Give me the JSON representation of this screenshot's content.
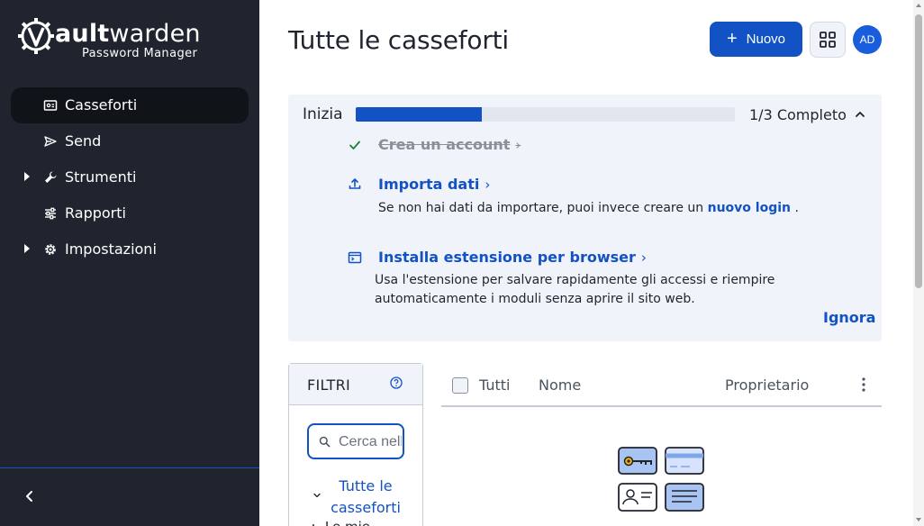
{
  "brand": {
    "word_light": "ault",
    "word_rest": "warden",
    "subtitle": "Password Manager",
    "logo_icon": "gear-v-logo"
  },
  "sidebar": {
    "items": [
      {
        "label": "Casseforti",
        "icon": "vault-icon",
        "active": true
      },
      {
        "label": "Send",
        "icon": "send-icon",
        "active": false
      },
      {
        "label": "Strumenti",
        "icon": "wrench-icon",
        "active": false,
        "expandable": true
      },
      {
        "label": "Rapporti",
        "icon": "sliders-icon",
        "active": false
      },
      {
        "label": "Impostazioni",
        "icon": "gear-icon",
        "active": false,
        "expandable": true
      }
    ],
    "collapse_icon": "chevron-left-icon"
  },
  "header": {
    "title": "Tutte le casseforti",
    "new_button": "Nuovo",
    "avatar_initials": "AD"
  },
  "onboarding": {
    "title": "Inizia",
    "progress_fraction": 0.333,
    "progress_text": "1/3 Completo",
    "tasks": [
      {
        "label": "Crea un account",
        "done": true,
        "icon": "check-icon"
      },
      {
        "label": "Importa dati",
        "done": false,
        "icon": "upload-icon",
        "desc_before": "Se non hai dati da importare, puoi invece creare un ",
        "desc_link": "nuovo login",
        "desc_after": " ."
      },
      {
        "label": "Installa estensione per browser",
        "done": false,
        "icon": "browser-icon",
        "desc": "Usa l'estensione per salvare rapidamente gli accessi e riempire automaticamente i moduli senza aprire il sito web."
      }
    ],
    "dismiss": "Ignora"
  },
  "filters": {
    "title": "FILTRI",
    "search_placeholder": "Cerca nelle casseforti",
    "all_vaults": "Tutte le casseforti",
    "my_vault": "Le mie"
  },
  "table": {
    "col_all": "Tutti",
    "col_name": "Nome",
    "col_owner": "Proprietario"
  },
  "colors": {
    "sidebar_bg": "#1f242e",
    "accent": "#1252c4",
    "panel_bg": "#f0f3f9"
  }
}
